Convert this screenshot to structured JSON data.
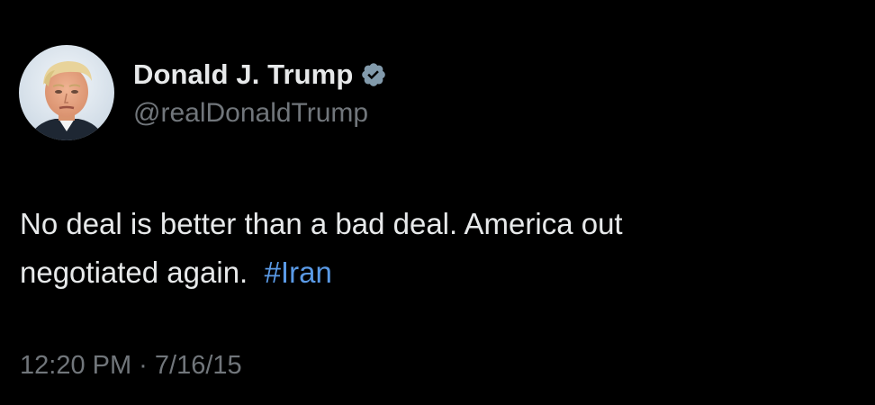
{
  "tweet": {
    "display_name": "Donald J. Trump",
    "handle": "@realDonaldTrump",
    "verified_icon": "verified-badge-icon",
    "text_line1": "No deal is better than a bad deal. America out",
    "text_line2": "negotiated again.",
    "hashtag": "#Iran",
    "timestamp": "12:20 PM · 7/16/15"
  },
  "colors": {
    "background": "#000000",
    "primary_text": "#e7e9ea",
    "secondary_text": "#71767b",
    "link": "#5a9ae6",
    "verified_badge": "#829aab"
  }
}
